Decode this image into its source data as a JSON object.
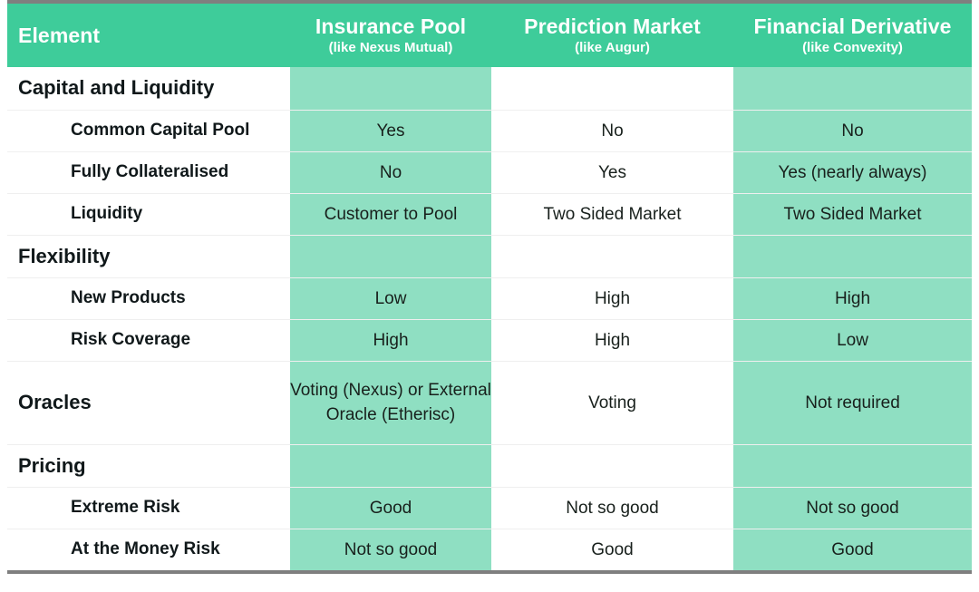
{
  "table": {
    "columns": [
      {
        "key": "element",
        "main": "Element",
        "sub": ""
      },
      {
        "key": "insurance",
        "main": "Insurance Pool",
        "sub": "(like Nexus Mutual)"
      },
      {
        "key": "prediction",
        "main": "Prediction Market",
        "sub": "(like Augur)"
      },
      {
        "key": "derivative",
        "main": "Financial Derivative",
        "sub": "(like Convexity)"
      }
    ],
    "rows": [
      {
        "type": "section",
        "label": "Capital and Liquidity",
        "insurance": "",
        "prediction": "",
        "derivative": ""
      },
      {
        "type": "item",
        "label": "Common Capital Pool",
        "insurance": "Yes",
        "prediction": "No",
        "derivative": "No"
      },
      {
        "type": "item",
        "label": "Fully Collateralised",
        "insurance": "No",
        "prediction": "Yes",
        "derivative": "Yes (nearly always)"
      },
      {
        "type": "item",
        "label": "Liquidity",
        "insurance": "Customer to Pool",
        "prediction": "Two Sided Market",
        "derivative": "Two Sided Market"
      },
      {
        "type": "section",
        "label": "Flexibility",
        "insurance": "",
        "prediction": "",
        "derivative": ""
      },
      {
        "type": "item",
        "label": "New Products",
        "insurance": "Low",
        "prediction": "High",
        "derivative": "High"
      },
      {
        "type": "item",
        "label": "Risk Coverage",
        "insurance": "High",
        "prediction": "High",
        "derivative": "Low"
      },
      {
        "type": "tall",
        "label": "Oracles",
        "insurance": "Voting (Nexus) or External Oracle (Etherisc)",
        "prediction": "Voting",
        "derivative": "Not required"
      },
      {
        "type": "section",
        "label": "Pricing",
        "insurance": "",
        "prediction": "",
        "derivative": ""
      },
      {
        "type": "item",
        "label": "Extreme Risk",
        "insurance": "Good",
        "prediction": "Not so good",
        "derivative": "Not so good"
      },
      {
        "type": "item",
        "label": "At the Money Risk",
        "insurance": "Not so good",
        "prediction": "Good",
        "derivative": "Good"
      }
    ]
  },
  "colors": {
    "header_green": "#3ecc9a",
    "cell_green": "#8fdfc2",
    "rule_gray": "#7f7f7f",
    "row_divider": "#efefef",
    "text_dark": "#10181a",
    "header_text": "#ffffff"
  }
}
